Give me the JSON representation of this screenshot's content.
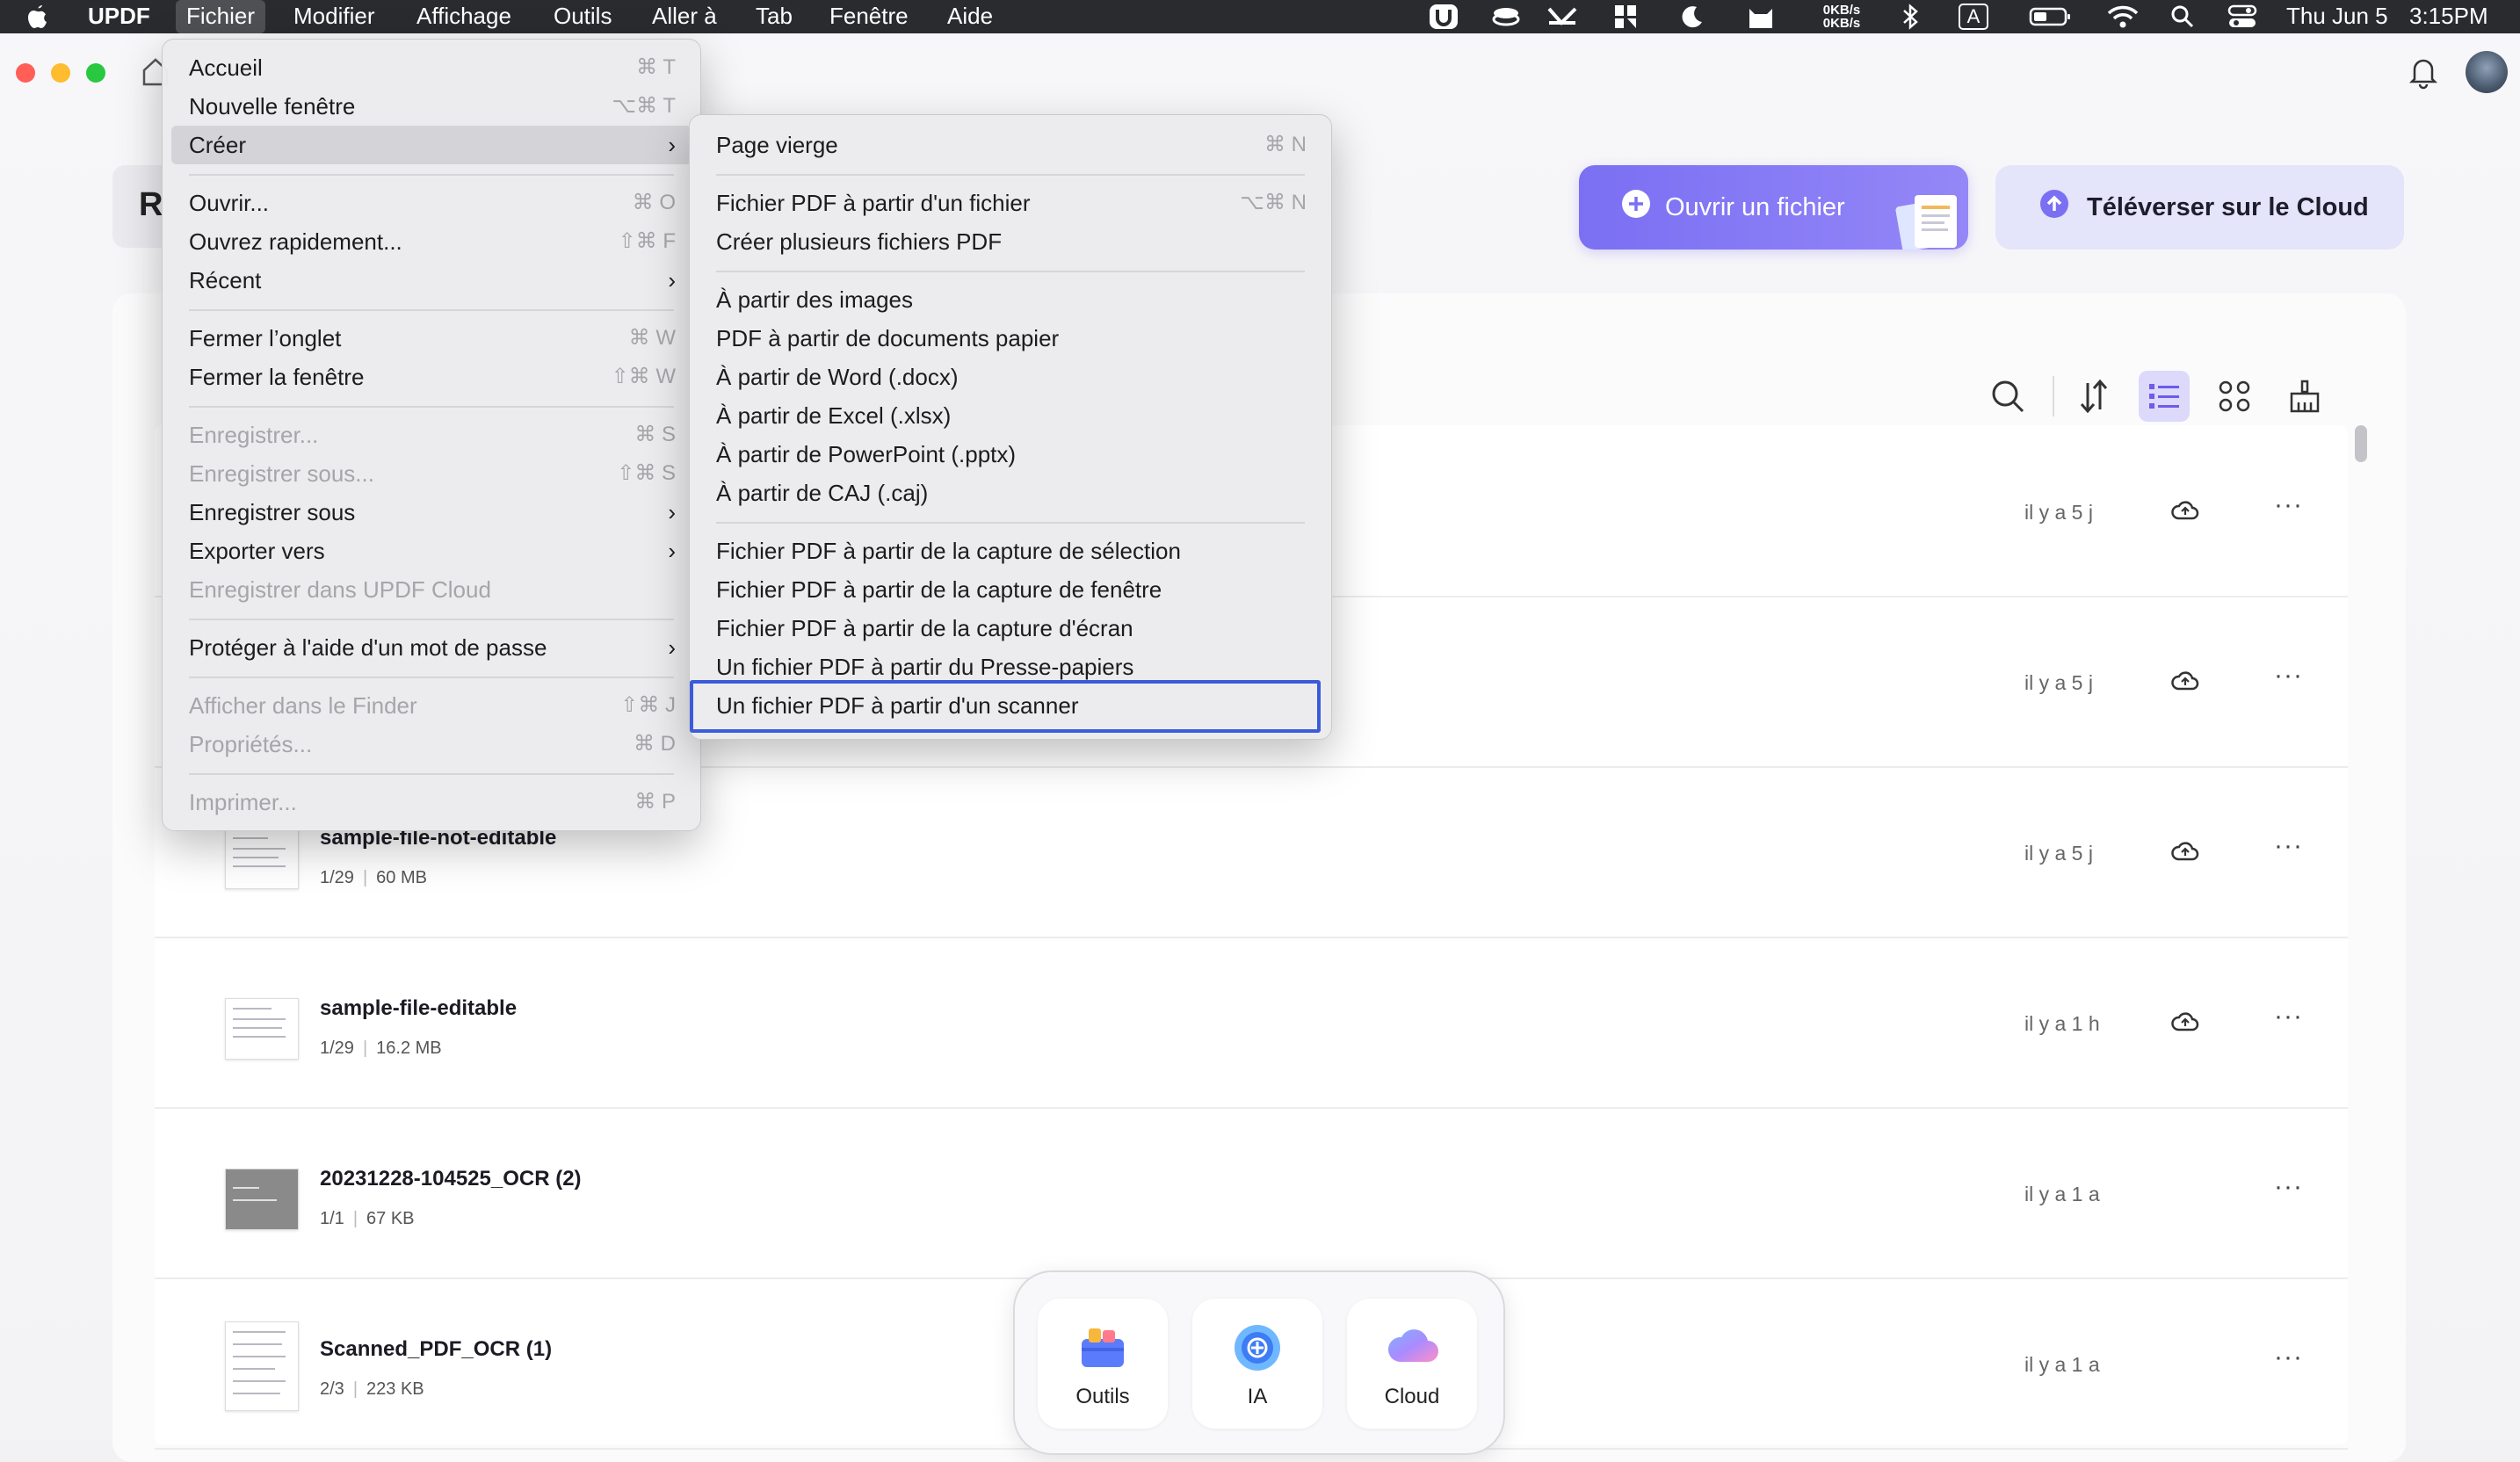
{
  "menubar": {
    "app_name": "UPDF",
    "items": [
      "Fichier",
      "Modifier",
      "Affichage",
      "Outils",
      "Aller à",
      "Tab",
      "Fenêtre",
      "Aide"
    ],
    "net_up": "0KB/s",
    "net_down": "0KB/s",
    "input_source": "A",
    "date": "Thu Jun 5",
    "time": "3:15PM"
  },
  "header": {
    "partial_title": "R",
    "open_file_label": "Ouvrir un fichier",
    "upload_cloud_label": "Téléverser sur le Cloud"
  },
  "files": [
    {
      "name": "",
      "meta_pages": "",
      "meta_size": "",
      "time": "il y a 5 j",
      "cloud": true
    },
    {
      "name": "",
      "meta_pages": "",
      "meta_size": "",
      "time": "il y a 5 j",
      "cloud": true
    },
    {
      "name": "sample-file-not-editable",
      "meta_pages": "1/29",
      "meta_size": "60 MB",
      "time": "il y a 5 j",
      "cloud": true
    },
    {
      "name": "sample-file-editable",
      "meta_pages": "1/29",
      "meta_size": "16.2 MB",
      "time": "il y a 1 h",
      "cloud": true
    },
    {
      "name": "20231228-104525_OCR (2)",
      "meta_pages": "1/1",
      "meta_size": "67 KB",
      "time": "il y a 1 a",
      "cloud": false
    },
    {
      "name": "Scanned_PDF_OCR (1)",
      "meta_pages": "2/3",
      "meta_size": "223 KB",
      "time": "il y a 1 a",
      "cloud": false
    }
  ],
  "more_glyph": "···",
  "dock": {
    "tools_label": "Outils",
    "ai_label": "IA",
    "cloud_label": "Cloud"
  },
  "file_menu": {
    "items": [
      {
        "label": "Accueil",
        "shortcut": "⌘ T"
      },
      {
        "label": "Nouvelle fenêtre",
        "shortcut": "⌥⌘ T"
      },
      {
        "label": "Créer",
        "shortcut": ""
      },
      {
        "label": "Ouvrir...",
        "shortcut": "⌘ O"
      },
      {
        "label": "Ouvrez rapidement...",
        "shortcut": "⇧⌘ F"
      },
      {
        "label": "Récent",
        "shortcut": ""
      },
      {
        "label": "Fermer l’onglet",
        "shortcut": "⌘ W"
      },
      {
        "label": "Fermer la fenêtre",
        "shortcut": "⇧⌘ W"
      },
      {
        "label": "Enregistrer...",
        "shortcut": "⌘ S"
      },
      {
        "label": "Enregistrer sous...",
        "shortcut": "⇧⌘ S"
      },
      {
        "label": "Enregistrer sous",
        "shortcut": ""
      },
      {
        "label": "Exporter vers",
        "shortcut": ""
      },
      {
        "label": "Enregistrer dans UPDF Cloud",
        "shortcut": ""
      },
      {
        "label": "Protéger à l'aide d'un mot de passe",
        "shortcut": ""
      },
      {
        "label": "Afficher dans le Finder",
        "shortcut": "⇧⌘ J"
      },
      {
        "label": "Propriétés...",
        "shortcut": "⌘ D"
      },
      {
        "label": "Imprimer...",
        "shortcut": "⌘ P"
      }
    ]
  },
  "create_submenu": {
    "items": [
      {
        "label": "Page vierge",
        "shortcut": "⌘ N"
      },
      {
        "label": "Fichier PDF à partir d'un fichier",
        "shortcut": "⌥⌘ N"
      },
      {
        "label": "Créer plusieurs fichiers PDF",
        "shortcut": ""
      },
      {
        "label": "À partir des images",
        "shortcut": ""
      },
      {
        "label": "PDF à partir de documents papier",
        "shortcut": ""
      },
      {
        "label": "À partir de Word (.docx)",
        "shortcut": ""
      },
      {
        "label": "À partir de Excel (.xlsx)",
        "shortcut": ""
      },
      {
        "label": "À partir de PowerPoint (.pptx)",
        "shortcut": ""
      },
      {
        "label": "À partir de CAJ (.caj)",
        "shortcut": ""
      },
      {
        "label": "Fichier PDF à partir de la capture de sélection",
        "shortcut": ""
      },
      {
        "label": "Fichier PDF à partir de la capture de fenêtre",
        "shortcut": ""
      },
      {
        "label": "Fichier PDF à partir de la capture d'écran",
        "shortcut": ""
      },
      {
        "label": "Un fichier PDF à partir du Presse-papiers",
        "shortcut": ""
      },
      {
        "label": "Un fichier PDF à partir d'un scanner",
        "shortcut": ""
      }
    ]
  },
  "colors": {
    "accent": "#7b6ff3",
    "highlight_box": "#3b5bdb",
    "menubar_bg": "#2a2b2f"
  }
}
